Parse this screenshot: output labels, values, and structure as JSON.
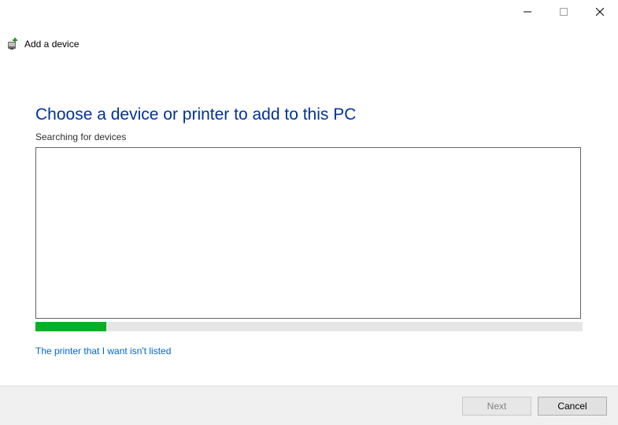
{
  "window": {
    "title": "Add a device"
  },
  "content": {
    "heading": "Choose a device or printer to add to this PC",
    "status": "Searching for devices",
    "link_not_listed": "The printer that I want isn't listed",
    "progress_percent": 13
  },
  "footer": {
    "next_label": "Next",
    "cancel_label": "Cancel"
  }
}
